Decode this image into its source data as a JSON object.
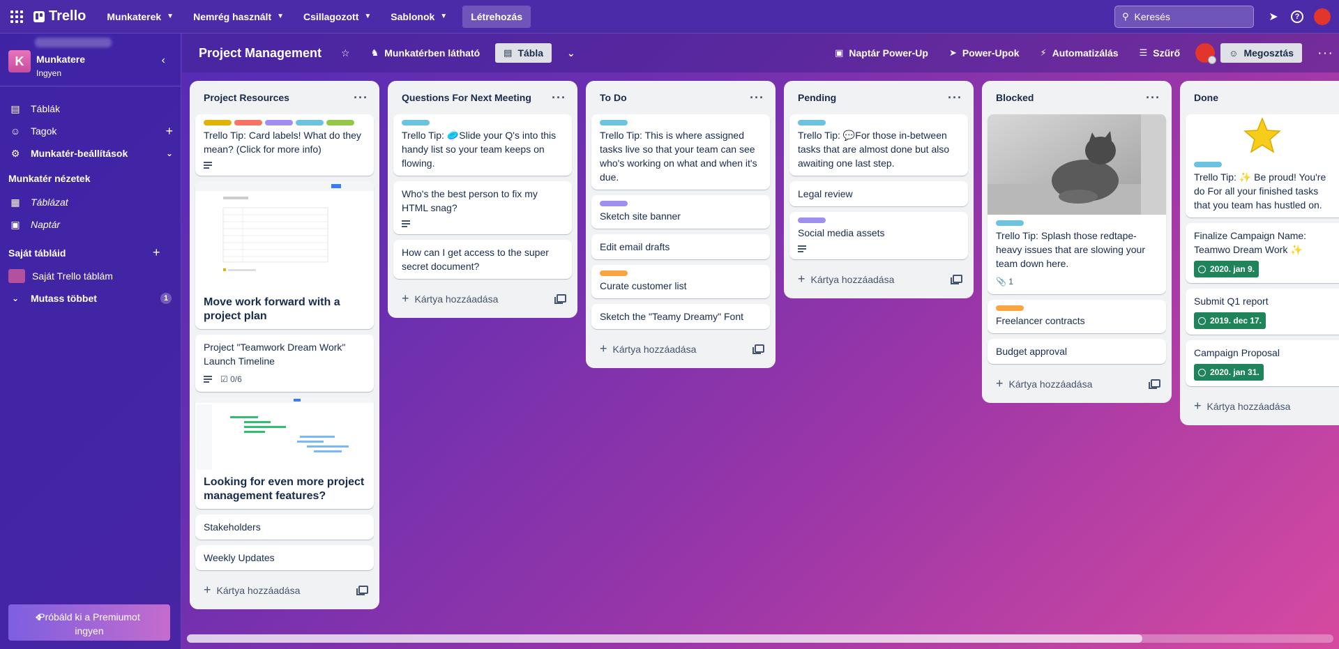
{
  "topnav": {
    "brand": "Trello",
    "items": [
      {
        "label": "Munkaterek"
      },
      {
        "label": "Nemrég használt"
      },
      {
        "label": "Csillagozott"
      },
      {
        "label": "Sablonok"
      }
    ],
    "create_label": "Létrehozás",
    "search_placeholder": "Keresés"
  },
  "sidebar": {
    "workspace_initial": "K",
    "workspace_name": "Munkatere",
    "workspace_plan": "Ingyen",
    "items": [
      {
        "label": "Táblák",
        "icon": "board-icon"
      },
      {
        "label": "Tagok",
        "icon": "person-icon"
      },
      {
        "label": "Munkatér-beállítások",
        "icon": "gear-icon"
      }
    ],
    "views_heading": "Munkatér nézetek",
    "views": [
      {
        "label": "Táblázat",
        "icon": "table-icon"
      },
      {
        "label": "Naptár",
        "icon": "calendar-icon"
      }
    ],
    "boards_heading": "Saját tábláid",
    "boards": [
      {
        "label": "Saját Trello táblám",
        "color": "#b4519f"
      }
    ],
    "show_more_label": "Mutass többet",
    "show_more_count": "1",
    "premium_line1": "Próbáld ki a Premiumot",
    "premium_line2": "ingyen"
  },
  "board_header": {
    "title": "Project Management",
    "visibility": "Munkatérben látható",
    "view": "Tábla",
    "calendar_powerup": "Naptár Power-Up",
    "powerups": "Power-Upok",
    "automation": "Automatizálás",
    "filter": "Szűrő",
    "share": "Megosztás"
  },
  "add_card_label": "Kártya hozzáadása",
  "lists": [
    {
      "title": "Project Resources",
      "cards": [
        {
          "text": "Trello Tip: Card labels! What do they mean? (Click for more info)",
          "labels": [
            "#e2b203",
            "#f87462",
            "#9f8fef",
            "#6cc3e0",
            "#94c748"
          ]
        },
        {
          "title_big": "Move work forward with a project plan",
          "cover": "project-plan"
        },
        {
          "text": "Project \"Teamwork Dream Work\" Launch Timeline",
          "checklist": "0/6"
        },
        {
          "title_big": "Looking for even more project management features?",
          "cover": "timeline"
        },
        {
          "text": "Stakeholders"
        },
        {
          "text": "Weekly Updates"
        }
      ]
    },
    {
      "title": "Questions For Next Meeting",
      "cards": [
        {
          "text": "Trello Tip: 🥏Slide your Q's into this handy list so your team keeps on flowing.",
          "labels": [
            "#6cc3e0"
          ]
        },
        {
          "text": "Who's the best person to fix my HTML snag?"
        },
        {
          "text": "How can I get access to the super secret document?"
        }
      ]
    },
    {
      "title": "To Do",
      "cards": [
        {
          "text": "Trello Tip: This is where assigned tasks live so that your team can see who's working on what and when it's due.",
          "labels": [
            "#6cc3e0"
          ]
        },
        {
          "text": "Sketch site banner",
          "labels": [
            "#9f8fef"
          ]
        },
        {
          "text": "Edit email drafts"
        },
        {
          "text": "Curate customer list",
          "labels": [
            "#faa53d"
          ]
        },
        {
          "text": "Sketch the \"Teamy Dreamy\" Font"
        }
      ]
    },
    {
      "title": "Pending",
      "cards": [
        {
          "text": "Trello Tip: 💬For those in-between tasks that are almost done but also awaiting one last step.",
          "labels": [
            "#6cc3e0"
          ]
        },
        {
          "text": "Legal review"
        },
        {
          "text": "Social media assets",
          "labels": [
            "#9f8fef"
          ]
        }
      ]
    },
    {
      "title": "Blocked",
      "cards": [
        {
          "text": "Trello Tip: Splash those redtape-heavy issues that are slowing your team down here.",
          "labels": [
            "#6cc3e0"
          ],
          "cover": "cat",
          "attachments": "1"
        },
        {
          "text": "Freelancer contracts",
          "labels": [
            "#faa53d"
          ]
        },
        {
          "text": "Budget approval"
        }
      ]
    },
    {
      "title": "Done",
      "cards": [
        {
          "text": "Trello Tip: ✨ Be proud! You're do For all your finished tasks that you team has hustled on.",
          "labels": [
            "#6cc3e0"
          ],
          "cover": "star"
        },
        {
          "text": "Finalize Campaign Name: Teamwo Dream Work ✨",
          "date": "2020. jan 9."
        },
        {
          "text": "Submit Q1 report",
          "date": "2019. dec 17."
        },
        {
          "text": "Campaign Proposal",
          "date": "2020. jan 31."
        }
      ]
    }
  ]
}
